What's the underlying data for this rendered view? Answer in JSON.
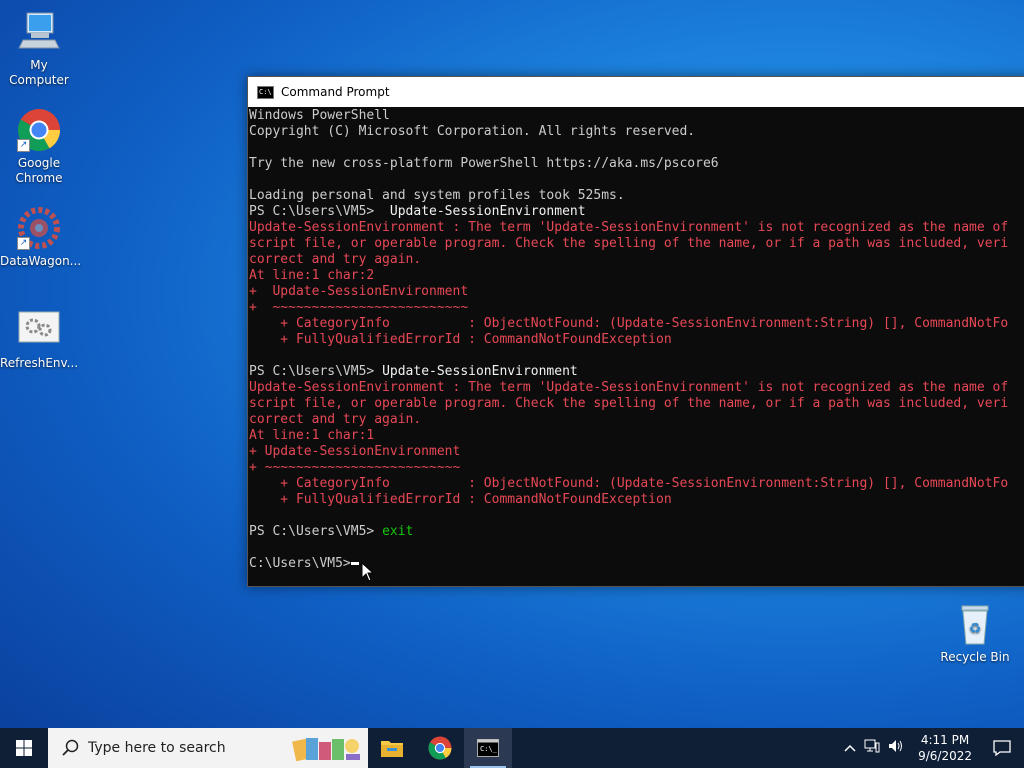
{
  "desktop": {
    "icons": [
      {
        "label": "My Computer"
      },
      {
        "label": "Google Chrome"
      },
      {
        "label": "DataWagon..."
      },
      {
        "label": "RefreshEnv..."
      },
      {
        "label": "Recycle Bin"
      }
    ]
  },
  "window": {
    "title": "Command Prompt",
    "lines": [
      {
        "text": "Windows PowerShell",
        "cls": ""
      },
      {
        "text": "Copyright (C) Microsoft Corporation. All rights reserved.",
        "cls": ""
      },
      {
        "text": "",
        "cls": ""
      },
      {
        "text": "Try the new cross-platform PowerShell https://aka.ms/pscore6",
        "cls": ""
      },
      {
        "text": "",
        "cls": ""
      },
      {
        "text": "Loading personal and system profiles took 525ms.",
        "cls": ""
      },
      {
        "prompt": "PS C:\\Users\\VM5> ",
        "cmd": " Update-SessionEnvironment",
        "cls": "prompt"
      },
      {
        "text": "Update-SessionEnvironment : The term 'Update-SessionEnvironment' is not recognized as the name of",
        "cls": "err"
      },
      {
        "text": "script file, or operable program. Check the spelling of the name, or if a path was included, veri",
        "cls": "err"
      },
      {
        "text": "correct and try again.",
        "cls": "err"
      },
      {
        "text": "At line:1 char:2",
        "cls": "err"
      },
      {
        "text": "+  Update-SessionEnvironment",
        "cls": "err"
      },
      {
        "text": "+  ~~~~~~~~~~~~~~~~~~~~~~~~~",
        "cls": "err"
      },
      {
        "text": "    + CategoryInfo          : ObjectNotFound: (Update-SessionEnvironment:String) [], CommandNotFo",
        "cls": "err"
      },
      {
        "text": "    + FullyQualifiedErrorId : CommandNotFoundException",
        "cls": "err"
      },
      {
        "text": "",
        "cls": ""
      },
      {
        "prompt": "PS C:\\Users\\VM5> ",
        "cmd": "Update-SessionEnvironment",
        "cls": "prompt"
      },
      {
        "text": "Update-SessionEnvironment : The term 'Update-SessionEnvironment' is not recognized as the name of",
        "cls": "err"
      },
      {
        "text": "script file, or operable program. Check the spelling of the name, or if a path was included, veri",
        "cls": "err"
      },
      {
        "text": "correct and try again.",
        "cls": "err"
      },
      {
        "text": "At line:1 char:1",
        "cls": "err"
      },
      {
        "text": "+ Update-SessionEnvironment",
        "cls": "err"
      },
      {
        "text": "+ ~~~~~~~~~~~~~~~~~~~~~~~~~",
        "cls": "err"
      },
      {
        "text": "    + CategoryInfo          : ObjectNotFound: (Update-SessionEnvironment:String) [], CommandNotFo",
        "cls": "err"
      },
      {
        "text": "    + FullyQualifiedErrorId : CommandNotFoundException",
        "cls": "err"
      },
      {
        "text": "",
        "cls": ""
      },
      {
        "prompt": "PS C:\\Users\\VM5> ",
        "cmd": "exit",
        "cls": "prompt-green"
      },
      {
        "text": "",
        "cls": ""
      },
      {
        "prompt": "C:\\Users\\VM5>",
        "cmd": "",
        "cls": "cursor-line"
      }
    ]
  },
  "taskbar": {
    "search_placeholder": "Type here to search",
    "time": "4:11 PM",
    "date": "9/6/2022"
  },
  "colors": {
    "console_bg": "#0c0c0c",
    "console_text": "#cccccc",
    "error_text": "#e74856",
    "green_text": "#16c60c",
    "taskbar_bg": "#0f1f36"
  }
}
